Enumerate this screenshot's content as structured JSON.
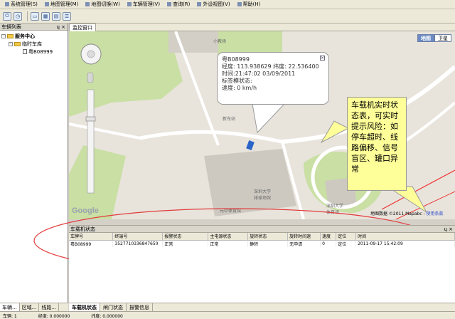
{
  "menu": {
    "items": [
      {
        "label": "系统管理(S)"
      },
      {
        "label": "地图管理(M)"
      },
      {
        "label": "地图切换(W)"
      },
      {
        "label": "车辆管理(V)"
      },
      {
        "label": "查询(R)"
      },
      {
        "label": "外设视图(V)"
      },
      {
        "label": "帮助(H)"
      }
    ]
  },
  "left_panel": {
    "title": "车辆列表",
    "pin": "ɥ ×",
    "tree": {
      "root": "服务中心",
      "child": "临时车库",
      "vehicle": "粤B08999"
    },
    "tabs": [
      "车辆...",
      "区域...",
      "线路..."
    ]
  },
  "map_panel": {
    "tab": "监控窗口",
    "map_types": [
      "地图",
      "卫星"
    ],
    "google_logo": "Google",
    "credit": "地图数据 ©2011 Mapabc - ",
    "credit_link": "使用条款",
    "labels": {
      "xiaojiao": "小教场",
      "chezhan": "新车站",
      "univ": "深圳大学\n排球场馆",
      "building2": "元中体育馆",
      "area": "深圳大学\n体育场"
    }
  },
  "popup": {
    "plate": "粤B08999",
    "lng_lat": "经度: 113.938629 纬度: 22.536400",
    "time": "时间:21:47:02 03/09/2011",
    "tag": "标签模状态:",
    "speed": "速度: 0 km/h",
    "close": "×"
  },
  "annotation": {
    "text": "车载机实时状态表，可实时提示风险：如停车超时、线路偏移、信号盲区、罐口异常"
  },
  "status_panel": {
    "title": "车载机状态",
    "pin": "ɥ ×",
    "columns": [
      "车牌号",
      "终端号",
      "报警状态",
      "主电源状态",
      "旋转状态",
      "旋转时间速",
      "速度",
      "定位",
      "时间"
    ],
    "rows": [
      [
        "粤B08999",
        "3527710336847650",
        "正常",
        "正常",
        "静转",
        "无申请",
        "0",
        "定位",
        "2011-09-17 15:42:09"
      ]
    ]
  },
  "bottom_tabs": [
    "车载机状态",
    "闸门状态",
    "报警信息"
  ],
  "statusbar": {
    "left": "车辆: 1",
    "mid": "经度: 0.000000",
    "right": "纬度: 0.000000"
  },
  "colors": {
    "annot_bg": "#ffff99",
    "ellipse": "#e13b3b",
    "map_green": "#c9dfa4"
  }
}
